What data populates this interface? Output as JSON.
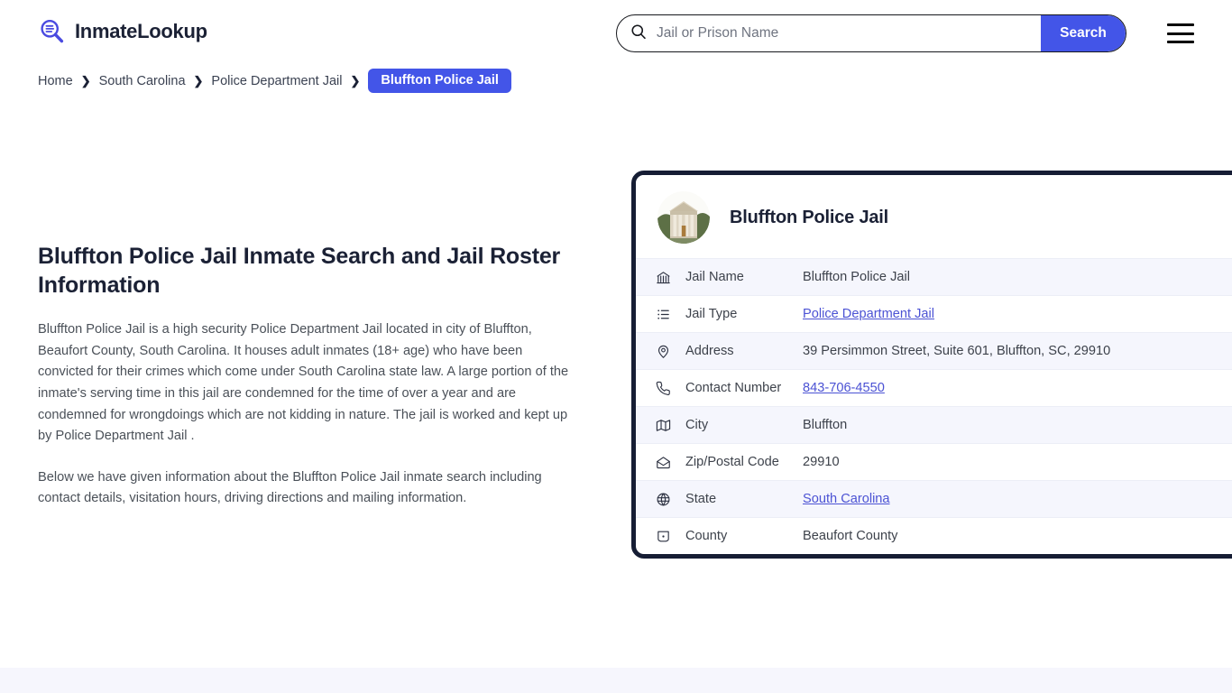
{
  "header": {
    "logo_text": "InmateLookup",
    "logo_icon": "search-list-logo-icon",
    "search": {
      "placeholder": "Jail or Prison Name",
      "value": "",
      "icon": "search-icon",
      "button_label": "Search"
    },
    "menu_icon": "hamburger-menu-icon"
  },
  "breadcrumb": {
    "items": [
      {
        "label": "Home"
      },
      {
        "label": "South Carolina"
      },
      {
        "label": "Police Department Jail"
      }
    ],
    "current": "Bluffton Police Jail",
    "separator": "❯"
  },
  "main": {
    "title": "Bluffton Police Jail Inmate Search and Jail Roster Information",
    "paragraph_1": "Bluffton Police Jail is a high security Police Department Jail located in city of Bluffton, Beaufort County, South Carolina. It houses adult inmates (18+ age) who have been convicted for their crimes which come under South Carolina state law. A large portion of the inmate's serving time in this jail are condemned for the time of over a year and are condemned for wrongdoings which are not kidding in nature. The jail is worked and kept up by Police Department Jail .",
    "paragraph_2": "Below we have given information about the Bluffton Police Jail inmate search including contact details, visitation hours, driving directions and mailing information."
  },
  "card": {
    "avatar_icon": "courthouse-photo",
    "title": "Bluffton Police Jail",
    "rows": [
      {
        "icon": "landmark-icon",
        "label": "Jail Name",
        "value": "Bluffton Police Jail",
        "is_link": false
      },
      {
        "icon": "list-icon",
        "label": "Jail Type",
        "value": "Police Department Jail",
        "is_link": true
      },
      {
        "icon": "map-pin-icon",
        "label": "Address",
        "value": "39 Persimmon Street, Suite 601, Bluffton, SC, 29910",
        "is_link": false
      },
      {
        "icon": "phone-icon",
        "label": "Contact Number",
        "value": "843-706-4550",
        "is_link": true
      },
      {
        "icon": "map-icon",
        "label": "City",
        "value": "Bluffton",
        "is_link": false
      },
      {
        "icon": "envelope-open-icon",
        "label": "Zip/Postal Code",
        "value": "29910",
        "is_link": false
      },
      {
        "icon": "globe-icon",
        "label": "State",
        "value": "South Carolina",
        "is_link": true
      },
      {
        "icon": "shield-badge-icon",
        "label": "County",
        "value": "Beaufort County",
        "is_link": false
      }
    ]
  },
  "colors": {
    "accent": "#4355e8",
    "link": "#4b52d4",
    "card_border": "#161d34",
    "row_alt_bg": "#f5f6fd",
    "text_dark": "#1b2135",
    "footer_band": "#f6f6fd"
  }
}
